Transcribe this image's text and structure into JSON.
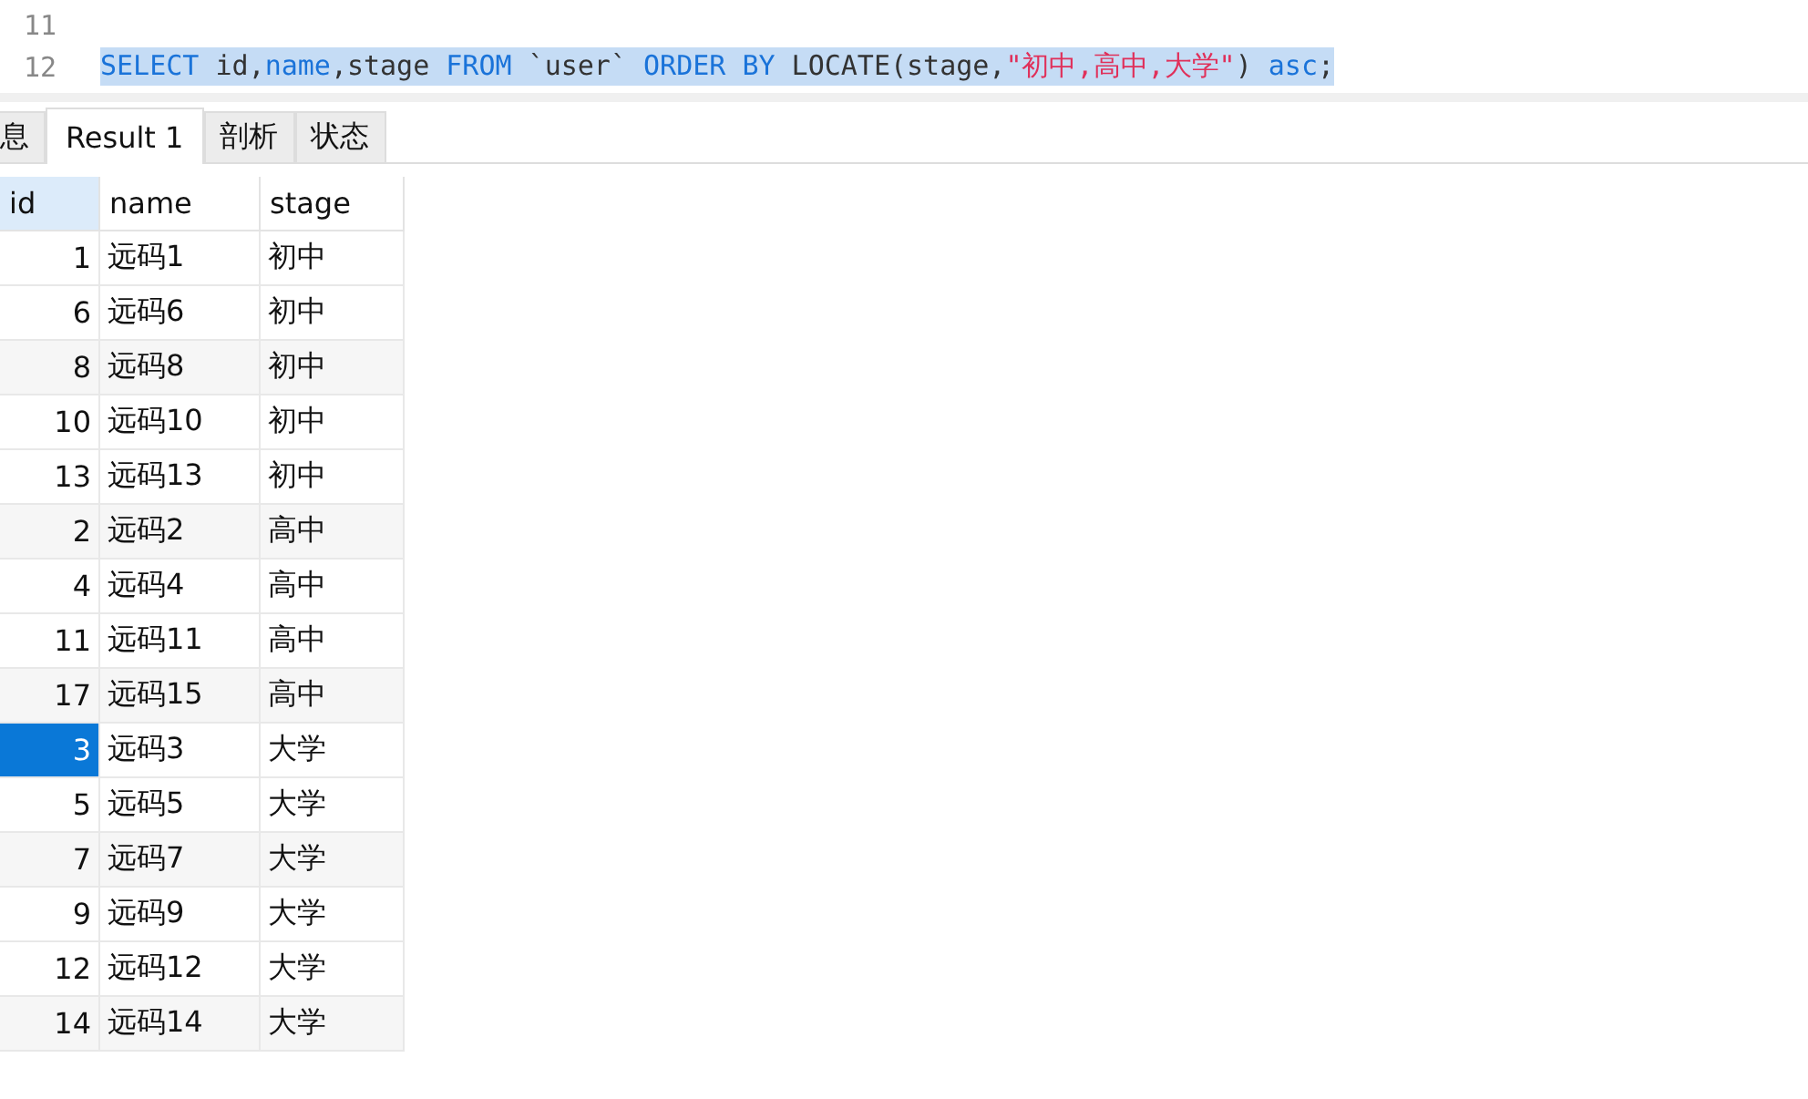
{
  "editor": {
    "lines": [
      {
        "number": "11"
      },
      {
        "number": "12",
        "selected": true,
        "tokens": [
          {
            "kind": "keyword",
            "text": "SELECT"
          },
          {
            "kind": "plain",
            "text": " id,"
          },
          {
            "kind": "keyword",
            "text": "name"
          },
          {
            "kind": "plain",
            "text": ",stage "
          },
          {
            "kind": "keyword",
            "text": "FROM"
          },
          {
            "kind": "plain",
            "text": " `user` "
          },
          {
            "kind": "keyword",
            "text": "ORDER BY"
          },
          {
            "kind": "plain",
            "text": " LOCATE(stage,"
          },
          {
            "kind": "string",
            "text": "\"初中,高中,大学\""
          },
          {
            "kind": "plain",
            "text": ") "
          },
          {
            "kind": "keyword",
            "text": "asc"
          },
          {
            "kind": "plain",
            "text": ";"
          }
        ]
      }
    ]
  },
  "tabs": [
    {
      "label": "息",
      "selected": false
    },
    {
      "label": "Result 1",
      "selected": true
    },
    {
      "label": "剖析",
      "selected": false
    },
    {
      "label": "状态",
      "selected": false
    }
  ],
  "table": {
    "columns": [
      "id",
      "name",
      "stage"
    ],
    "rows": [
      {
        "id": "1",
        "name": "远码1",
        "stage": "初中",
        "selected": false
      },
      {
        "id": "6",
        "name": "远码6",
        "stage": "初中",
        "selected": false
      },
      {
        "id": "8",
        "name": "远码8",
        "stage": "初中",
        "selected": false
      },
      {
        "id": "10",
        "name": "远码10",
        "stage": "初中",
        "selected": false
      },
      {
        "id": "13",
        "name": "远码13",
        "stage": "初中",
        "selected": false
      },
      {
        "id": "2",
        "name": "远码2",
        "stage": "高中",
        "selected": false
      },
      {
        "id": "4",
        "name": "远码4",
        "stage": "高中",
        "selected": false
      },
      {
        "id": "11",
        "name": "远码11",
        "stage": "高中",
        "selected": false
      },
      {
        "id": "17",
        "name": "远码15",
        "stage": "高中",
        "selected": false
      },
      {
        "id": "3",
        "name": "远码3",
        "stage": "大学",
        "selected": true
      },
      {
        "id": "5",
        "name": "远码5",
        "stage": "大学",
        "selected": false
      },
      {
        "id": "7",
        "name": "远码7",
        "stage": "大学",
        "selected": false
      },
      {
        "id": "9",
        "name": "远码9",
        "stage": "大学",
        "selected": false
      },
      {
        "id": "12",
        "name": "远码12",
        "stage": "大学",
        "selected": false
      },
      {
        "id": "14",
        "name": "远码14",
        "stage": "大学",
        "selected": false
      }
    ]
  }
}
